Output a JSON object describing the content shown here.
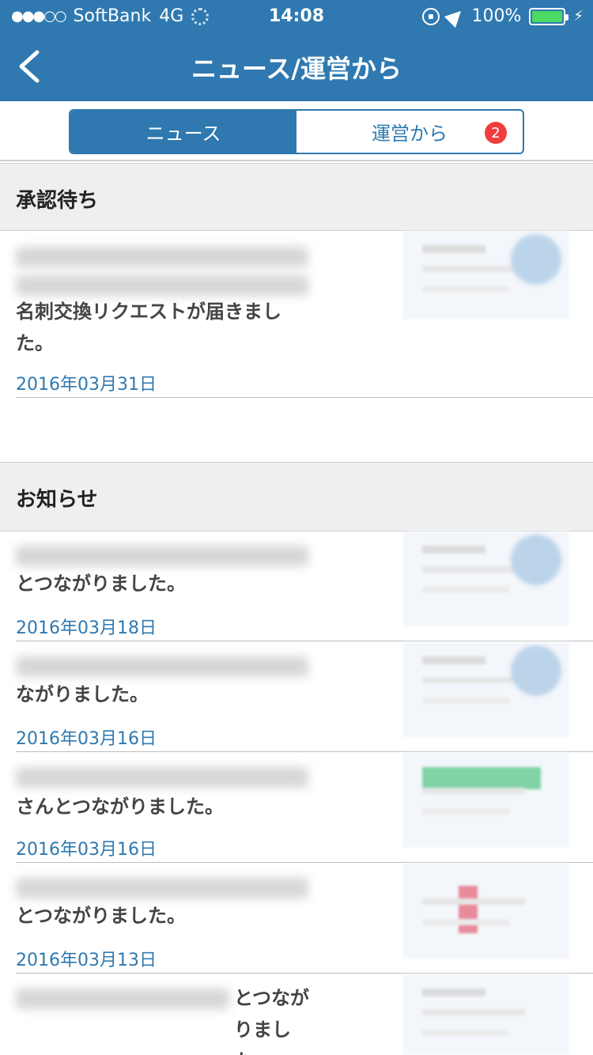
{
  "status_bar": {
    "carrier": "SoftBank",
    "network": "4G",
    "time": "14:08",
    "battery": "100%",
    "icons": [
      "signal-icon",
      "loading-icon",
      "orientation-lock-icon",
      "location-icon",
      "battery-icon",
      "charging-icon"
    ]
  },
  "nav": {
    "title": "ニュース/運営から",
    "back_icon": "chevron-left-icon"
  },
  "tabs": [
    {
      "label": "ニュース",
      "active": true
    },
    {
      "label": "運営から",
      "active": false,
      "badge": "2"
    }
  ],
  "sections": {
    "pending": {
      "title": "承認待ち",
      "items": [
        {
          "message": "名刺交換リクエストが届きました。",
          "date": "2016年03月31日"
        }
      ]
    },
    "notices": {
      "title": "お知らせ",
      "items": [
        {
          "message": "とつながりました。",
          "date": "2016年03月18日"
        },
        {
          "message": "ながりました。",
          "date": "2016年03月16日"
        },
        {
          "message": "さんとつながりました。",
          "date": "2016年03月16日"
        },
        {
          "message": "とつながりました。",
          "date": "2016年03月13日"
        },
        {
          "message": "とつながりました。",
          "date": ""
        }
      ]
    }
  },
  "colors": {
    "brand": "#2f79b0",
    "badge": "#f03c3c",
    "section_bg": "#efefef"
  }
}
